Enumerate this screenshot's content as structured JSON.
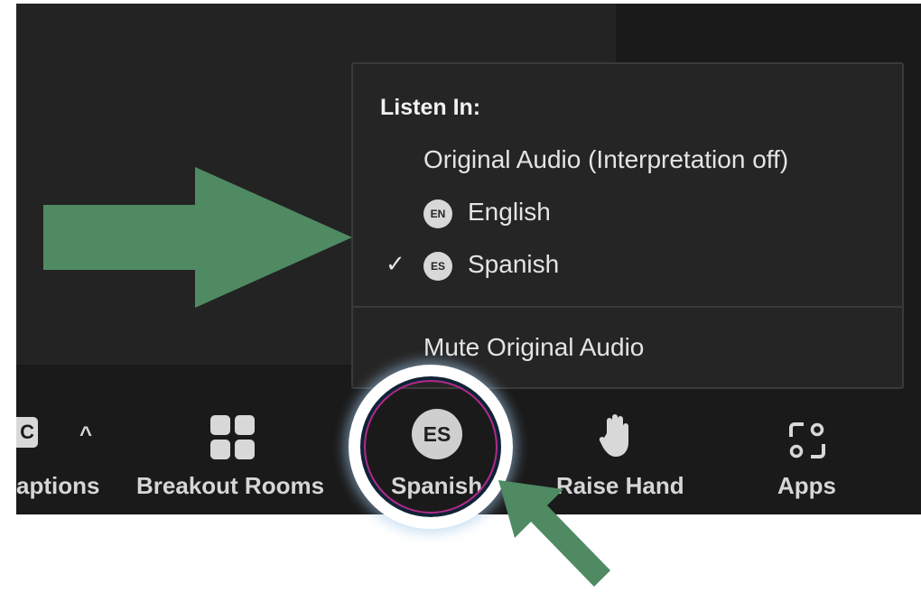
{
  "popup": {
    "heading": "Listen In:",
    "options": [
      {
        "label": "Original Audio (Interpretation off)",
        "badge": "",
        "checked": false
      },
      {
        "label": "English",
        "badge": "EN",
        "checked": false
      },
      {
        "label": "Spanish",
        "badge": "ES",
        "checked": true
      }
    ],
    "checkmark": "✓",
    "mute_label": "Mute Original Audio"
  },
  "toolbar": {
    "captions_icon_text": "C",
    "captions_label": "aptions",
    "caret": "^",
    "breakout_label": "Breakout Rooms",
    "language_badge": "ES",
    "language_label": "Spanish",
    "raise_hand_label": "Raise Hand",
    "apps_label": "Apps"
  },
  "colors": {
    "arrow": "#4f8a63",
    "background": "#1f1f1f",
    "popup": "#252525",
    "ring": "#ffffff",
    "ring_accent": "#b02a8a"
  }
}
